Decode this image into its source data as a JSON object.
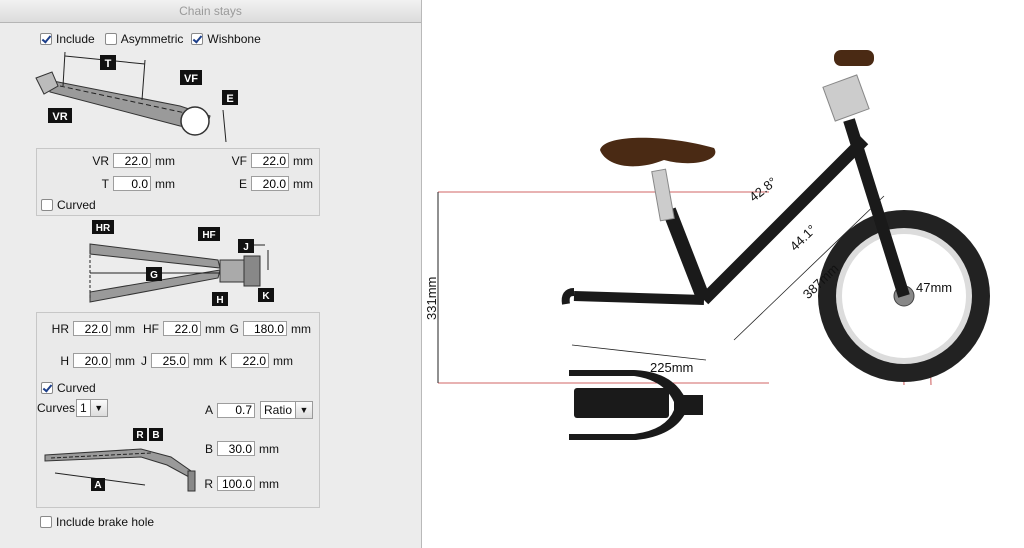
{
  "window": {
    "title": "Chain stays"
  },
  "top_options": {
    "include": "Include",
    "asymmetric": "Asymmetric",
    "wishbone": "Wishbone"
  },
  "diagram_labels": {
    "stay": {
      "t": "T",
      "vf": "VF",
      "vr": "VR",
      "e": "E"
    },
    "top": {
      "hr": "HR",
      "hf": "HF",
      "j": "J",
      "g": "G",
      "h": "H",
      "k": "K"
    },
    "curve": {
      "r": "R",
      "b": "B",
      "a": "A"
    }
  },
  "group1": {
    "vr": {
      "label": "VR",
      "value": "22.0",
      "unit": "mm"
    },
    "vf": {
      "label": "VF",
      "value": "22.0",
      "unit": "mm"
    },
    "t": {
      "label": "T",
      "value": "0.0",
      "unit": "mm"
    },
    "e": {
      "label": "E",
      "value": "20.0",
      "unit": "mm"
    },
    "curved": "Curved"
  },
  "group2": {
    "hr": {
      "label": "HR",
      "value": "22.0",
      "unit": "mm"
    },
    "hf": {
      "label": "HF",
      "value": "22.0",
      "unit": "mm"
    },
    "g": {
      "label": "G",
      "value": "180.0",
      "unit": "mm"
    },
    "h": {
      "label": "H",
      "value": "20.0",
      "unit": "mm"
    },
    "j": {
      "label": "J",
      "value": "25.0",
      "unit": "mm"
    },
    "k": {
      "label": "K",
      "value": "22.0",
      "unit": "mm"
    },
    "curved": "Curved",
    "curves_label": "Curves",
    "curves_value": "1",
    "a": {
      "label": "A",
      "value": "0.7",
      "mode": "Ratio"
    },
    "b": {
      "label": "B",
      "value": "30.0",
      "unit": "mm"
    },
    "r": {
      "label": "R",
      "value": "100.0",
      "unit": "mm"
    }
  },
  "brake_hole": "Include brake hole",
  "drawing": {
    "angle_top": "42.8°",
    "angle_down": "44.1°",
    "length_down": "387mm",
    "wheel_offset": "47mm",
    "height": "331mm",
    "chainstay": "225mm"
  },
  "colors": {
    "frame": "#1a1a1a",
    "saddle": "#4a2a14",
    "tire": "#222222",
    "dim": "#c03030"
  }
}
